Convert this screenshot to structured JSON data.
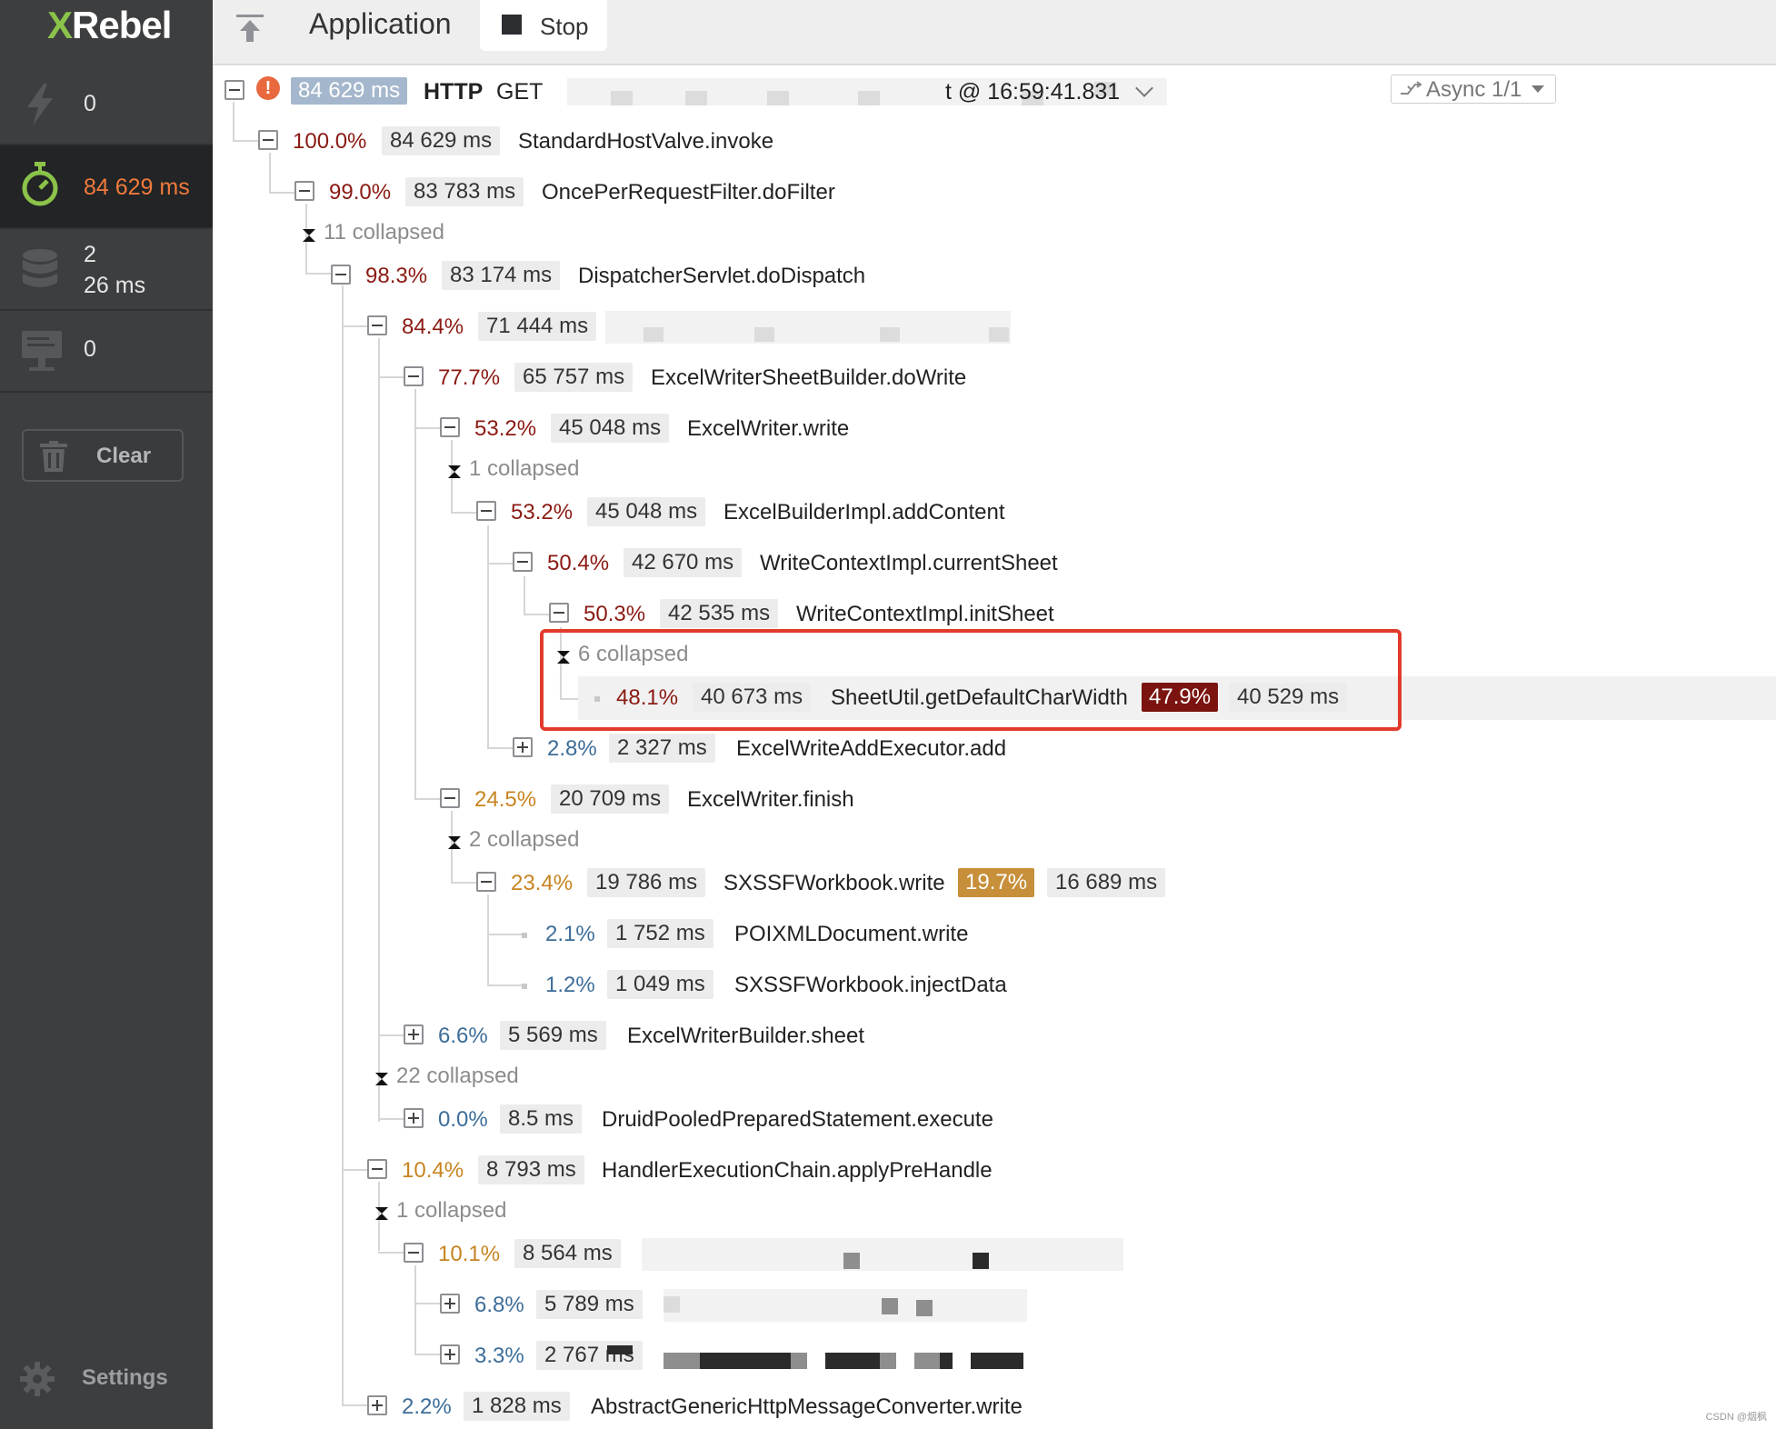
{
  "sidebar": {
    "brand_x": "X",
    "brand_rest": "Rebel",
    "exceptions_count": "0",
    "time_value": "84 629 ms",
    "db_count": "2",
    "db_time": "26 ms",
    "remote_count": "0",
    "clear_label": "Clear",
    "settings_label": "Settings"
  },
  "topbar": {
    "app_label": "Application",
    "stop_label": "Stop"
  },
  "request": {
    "duration": "84 629 ms",
    "protocol": "HTTP",
    "method": "GET",
    "url_tail": "t @ 16:59:41.831",
    "async_label": "Async 1/1"
  },
  "tree": {
    "r1": {
      "pct": "100.0%",
      "ms": "84 629 ms",
      "method": "StandardHostValve.invoke"
    },
    "r2": {
      "pct": "99.0%",
      "ms": "83 783 ms",
      "method": "OncePerRequestFilter.doFilter"
    },
    "c1": "11 collapsed",
    "r3": {
      "pct": "98.3%",
      "ms": "83 174 ms",
      "method": "DispatcherServlet.doDispatch"
    },
    "r4": {
      "pct": "84.4%",
      "ms": "71 444 ms"
    },
    "r5": {
      "pct": "77.7%",
      "ms": "65 757 ms",
      "method": "ExcelWriterSheetBuilder.doWrite"
    },
    "r6": {
      "pct": "53.2%",
      "ms": "45 048 ms",
      "method": "ExcelWriter.write"
    },
    "c2": "1 collapsed",
    "r7": {
      "pct": "53.2%",
      "ms": "45 048 ms",
      "method": "ExcelBuilderImpl.addContent"
    },
    "r8": {
      "pct": "50.4%",
      "ms": "42 670 ms",
      "method": "WriteContextImpl.currentSheet"
    },
    "r9": {
      "pct": "50.3%",
      "ms": "42 535 ms",
      "method": "WriteContextImpl.initSheet"
    },
    "c3": "6 collapsed",
    "r10": {
      "pct": "48.1%",
      "ms": "40 673 ms",
      "method": "SheetUtil.getDefaultCharWidth",
      "self_pct": "47.9%",
      "self_ms": "40 529 ms"
    },
    "r11": {
      "pct": "2.8%",
      "ms": "2 327 ms",
      "method": "ExcelWriteAddExecutor.add"
    },
    "r12": {
      "pct": "24.5%",
      "ms": "20 709 ms",
      "method": "ExcelWriter.finish"
    },
    "c4": "2 collapsed",
    "r13": {
      "pct": "23.4%",
      "ms": "19 786 ms",
      "method": "SXSSFWorkbook.write",
      "self_pct": "19.7%",
      "self_ms": "16 689 ms"
    },
    "r14": {
      "pct": "2.1%",
      "ms": "1 752 ms",
      "method": "POIXMLDocument.write"
    },
    "r15": {
      "pct": "1.2%",
      "ms": "1 049 ms",
      "method": "SXSSFWorkbook.injectData"
    },
    "r16": {
      "pct": "6.6%",
      "ms": "5 569 ms",
      "method": "ExcelWriterBuilder.sheet"
    },
    "c5": "22 collapsed",
    "r17": {
      "pct": "0.0%",
      "ms": "8.5 ms",
      "method": "DruidPooledPreparedStatement.execute"
    },
    "r18": {
      "pct": "10.4%",
      "ms": "8 793 ms",
      "method": "HandlerExecutionChain.applyPreHandle"
    },
    "c6": "1 collapsed",
    "r19": {
      "pct": "10.1%",
      "ms": "8 564 ms"
    },
    "r20": {
      "pct": "6.8%",
      "ms": "5 789 ms"
    },
    "r21": {
      "pct": "3.3%",
      "ms": "2 767 ms"
    },
    "r22": {
      "pct": "2.2%",
      "ms": "1 828 ms",
      "method": "AbstractGenericHttpMessageConverter.write"
    }
  },
  "watermark": "CSDN @烟枫",
  "colors": {
    "sidebar_bg": "#3d3e40",
    "accent_orange": "#f07a3c",
    "pct_red": "#8a1a12",
    "pct_orange": "#c78421",
    "pct_blue": "#3d6d99",
    "highlight_box": "#e23b2c"
  }
}
